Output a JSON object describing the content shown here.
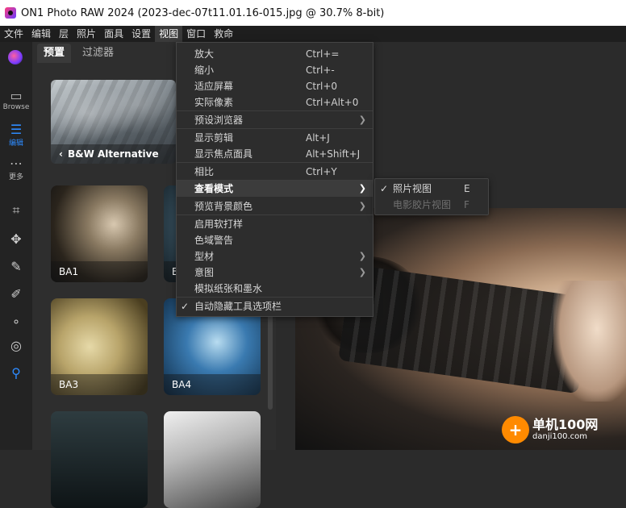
{
  "window": {
    "title": "ON1 Photo RAW 2024 (2023-dec-07t11.01.16-015.jpg @ 30.7% 8-bit)"
  },
  "menubar": [
    "文件",
    "编辑",
    "层",
    "照片",
    "面具",
    "设置",
    "视图",
    "窗口",
    "救命"
  ],
  "leftbar": {
    "browse_label": "Browse",
    "edit_label": "编辑",
    "more_label": "更多",
    "icons": [
      "crop-icon",
      "move-icon",
      "magic-wand-icon",
      "brush-icon",
      "clone-icon",
      "fingerprint-icon",
      "zoom-icon"
    ]
  },
  "panel": {
    "tabs": [
      "预置",
      "过滤器"
    ],
    "hero_label": "B&W Alternative",
    "thumbs": [
      "BA1",
      "B",
      "BA3",
      "BA4",
      "",
      ""
    ]
  },
  "view_menu": {
    "items": [
      {
        "label": "放大",
        "shortcut": "Ctrl+="
      },
      {
        "label": "缩小",
        "shortcut": "Ctrl+-"
      },
      {
        "label": "适应屏幕",
        "shortcut": "Ctrl+0"
      },
      {
        "label": "实际像素",
        "shortcut": "Ctrl+Alt+0"
      },
      {
        "label": "预设浏览器",
        "shortcut": ""
      },
      {
        "label": "显示剪辑",
        "shortcut": "Alt+J"
      },
      {
        "label": "显示焦点面具",
        "shortcut": "Alt+Shift+J"
      },
      {
        "label": "相比",
        "shortcut": "Ctrl+Y"
      },
      {
        "label": "查看模式",
        "shortcut": ""
      },
      {
        "label": "预览背景颜色",
        "shortcut": ""
      },
      {
        "label": "启用软打样",
        "shortcut": ""
      },
      {
        "label": "色域警告",
        "shortcut": ""
      },
      {
        "label": "型材",
        "shortcut": ""
      },
      {
        "label": "意图",
        "shortcut": ""
      },
      {
        "label": "模拟纸张和墨水",
        "shortcut": ""
      },
      {
        "label": "自动隐藏工具选项栏",
        "shortcut": ""
      }
    ]
  },
  "view_mode_submenu": {
    "items": [
      {
        "label": "照片视图",
        "shortcut": "E"
      },
      {
        "label": "电影胶片视图",
        "shortcut": "F"
      }
    ]
  },
  "watermark": {
    "big": "单机100网",
    "small": "danji100.com"
  },
  "colors": {
    "accent": "#2e8bff",
    "menu_bg": "#2d2d2d",
    "app_bg": "#2b2b2b"
  }
}
